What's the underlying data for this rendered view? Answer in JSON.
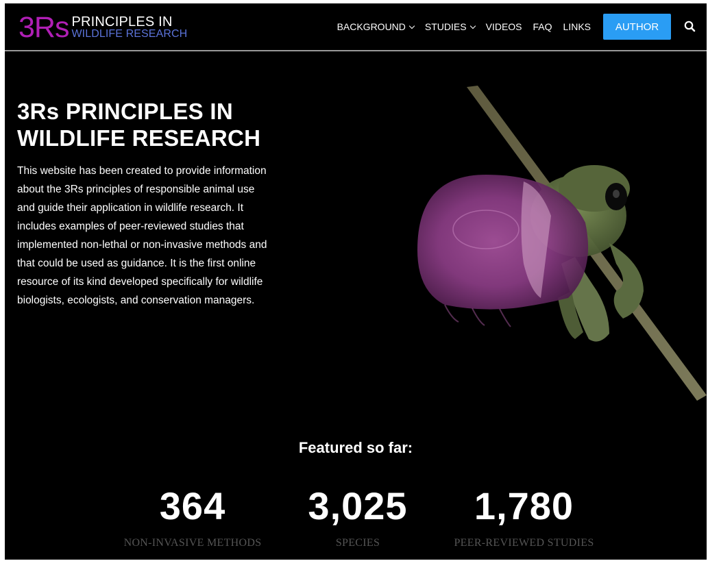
{
  "header": {
    "logo": {
      "mark": "3Rs",
      "line1": "PRINCIPLES IN",
      "line2": "WILDLIFE RESEARCH"
    },
    "nav": [
      {
        "label": "BACKGROUND",
        "dropdown": true
      },
      {
        "label": "STUDIES",
        "dropdown": true
      },
      {
        "label": "VIDEOS",
        "dropdown": false
      },
      {
        "label": "FAQ",
        "dropdown": false
      },
      {
        "label": "LINKS",
        "dropdown": false
      }
    ],
    "author_button": "AUTHOR",
    "search_icon": "search-icon"
  },
  "hero": {
    "title": "3Rs PRINCIPLES IN WILDLIFE RESEARCH",
    "description": "This website has been created to provide information about the 3Rs principles of responsible animal use and guide their application in wildlife research. It includes examples of peer-reviewed studies that implemented non-lethal or non-invasive methods and that could be used as guidance. It is the first online resource of its kind developed specifically for wildlife biologists, ecologists, and conservation managers.",
    "image": "frog-and-jellyfish-illustration"
  },
  "stats": {
    "title": "Featured so far:",
    "items": [
      {
        "value": "364",
        "label": "NON-INVASIVE METHODS"
      },
      {
        "value": "3,025",
        "label": "SPECIES"
      },
      {
        "value": "1,780",
        "label": "PEER-REVIEWED STUDIES"
      }
    ]
  },
  "colors": {
    "background": "#000000",
    "logo_mark": "#b01fb5",
    "logo_sub": "#5b73d9",
    "accent_button": "#2a9df4",
    "stat_label": "#555555"
  }
}
